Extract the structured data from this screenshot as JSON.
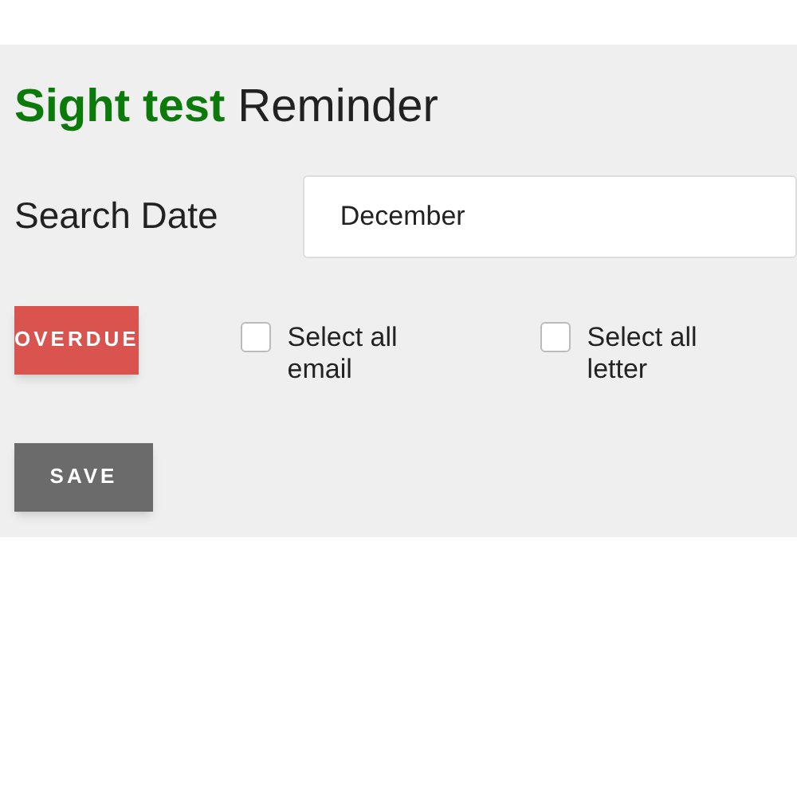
{
  "title": "**Sight test** Reminder",
  "search": {
    "label": "Search Date",
    "value": "December"
  },
  "overdue_button": "OVERDUE",
  "checkboxes": [
    {
      "label": "Select all email",
      "checked": false
    },
    {
      "label": "Select all letter",
      "checked": false
    }
  ],
  "save_button": "SAVE"
}
